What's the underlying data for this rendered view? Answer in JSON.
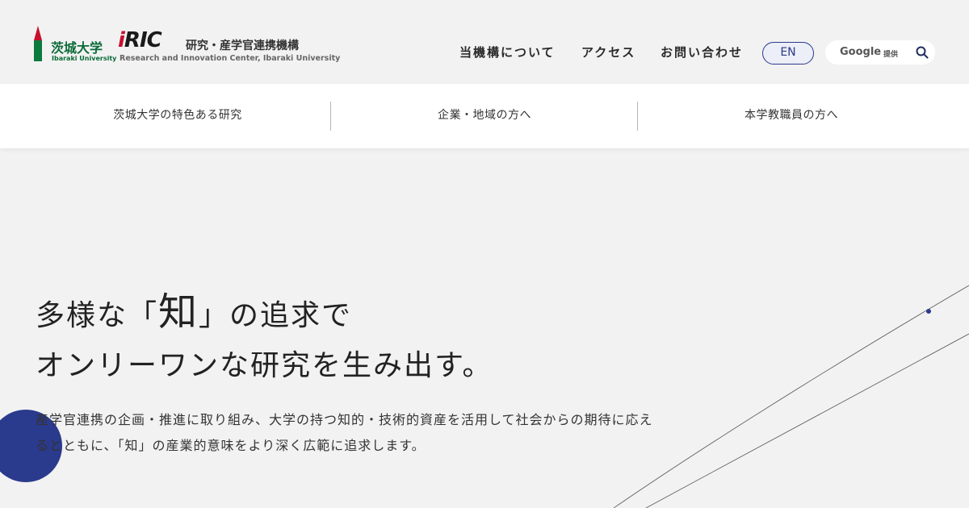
{
  "header": {
    "ibaraki_logo": {
      "jp": "茨城大学",
      "en": "Ibaraki University"
    },
    "iric_logo": {
      "mark": "iRIC",
      "jp": "研究・産学官連携機構",
      "en": "Research and Innovation Center, Ibaraki University"
    },
    "nav": {
      "about": "当機構について",
      "access": "アクセス",
      "contact": "お問い合わせ"
    },
    "lang_button": "EN",
    "search": {
      "provider": "Google",
      "provider_sub": "提供",
      "icon": "search-icon"
    }
  },
  "subnav": {
    "items": [
      {
        "label": "茨城大学の特色ある研究"
      },
      {
        "label": "企業・地域の方へ"
      },
      {
        "label": "本学教職員の方へ"
      }
    ]
  },
  "hero": {
    "headline_line1_before": "多様な「",
    "headline_line1_emphasis": "知",
    "headline_line1_after": "」の追求で",
    "headline_line2": "オンリーワンな研究を生み出す。",
    "description": "産学官連携の企画・推進に取り組み、大学の持つ知的・技術的資産を活用して社会からの期待に応えるとともに、「知」の産業的意味をより深く広範に追求します。"
  },
  "colors": {
    "background": "#f2f2f2",
    "accent_navy": "#2a3a8c",
    "brand_green": "#0a6b38",
    "brand_red": "#c8102e"
  }
}
